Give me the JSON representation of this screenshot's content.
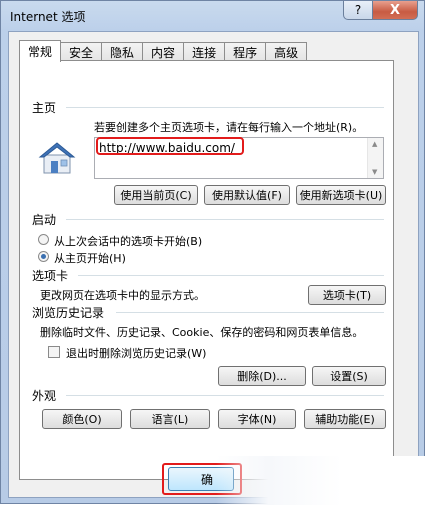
{
  "window": {
    "title": "Internet 选项",
    "help_label": "?",
    "close_label": "X"
  },
  "tabs": [
    "常规",
    "安全",
    "隐私",
    "内容",
    "连接",
    "程序",
    "高级"
  ],
  "homepage": {
    "group_title": "主页",
    "description": "若要创建多个主页选项卡，请在每行输入一个地址(R)。",
    "url": "http://www.baidu.com/",
    "buttons": [
      "使用当前页(C)",
      "使用默认值(F)",
      "使用新选项卡(U)"
    ]
  },
  "startup": {
    "group_title": "启动",
    "options": [
      {
        "label": "从上次会话中的选项卡开始(B)",
        "checked": false
      },
      {
        "label": "从主页开始(H)",
        "checked": true
      }
    ]
  },
  "tabs_group": {
    "group_title": "选项卡",
    "description": "更改网页在选项卡中的显示方式。",
    "button": "选项卡(T)"
  },
  "history": {
    "group_title": "浏览历史记录",
    "description": "删除临时文件、历史记录、Cookie、保存的密码和网页表单信息。",
    "checkbox_label": "退出时删除浏览历史记录(W)",
    "delete_button": "删除(D)...",
    "settings_button": "设置(S)"
  },
  "appearance": {
    "group_title": "外观",
    "buttons": [
      "颜色(O)",
      "语言(L)",
      "字体(N)",
      "辅助功能(E)"
    ]
  },
  "footer": {
    "ok_label": "确"
  },
  "colors": {
    "highlight": "#e21b1b"
  }
}
